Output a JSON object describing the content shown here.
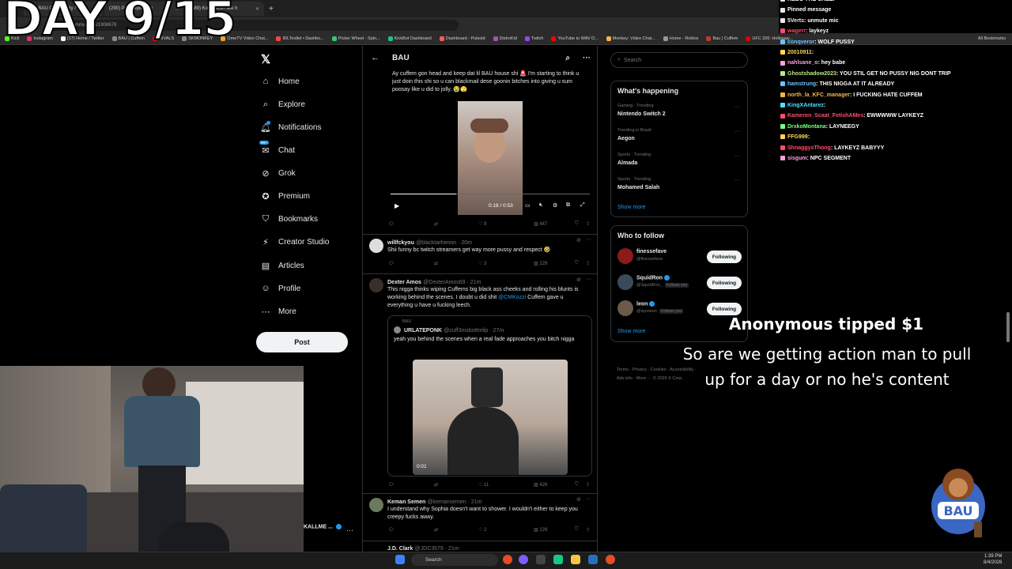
{
  "overlay": {
    "day_label": "DAY 9/15"
  },
  "browser": {
    "tabs": [
      {
        "label": "(91) BAU Community / X"
      },
      {
        "label": "(290) Post replies by"
      },
      {
        "label": "(289) Kozzi actin like h"
      }
    ],
    "url": "x.com/i/communities/1908678",
    "bookmarks": [
      "Kick",
      "Instagram",
      "(17) Home / Twitter",
      "BAU | Cuffem",
      "RIVALS",
      "SKMONKEY",
      "OmeTV Video Chat...",
      "IRLToolkit • Dashbo...",
      "Picker Wheel - Spin...",
      "KickBot Dashboard",
      "Dashboard - Pulsoid",
      "DistroKid",
      "Twitch",
      "YouTube to WAV D...",
      "Monkey: Video Chat...",
      "Home - Roblox",
      "Bau | Cuffem",
      "UFC 326: Holloway..."
    ],
    "all_bookmarks": "All Bookmarks"
  },
  "nav": {
    "items": [
      {
        "label": "Home",
        "icon": "home-icon"
      },
      {
        "label": "Explore",
        "icon": "search-icon"
      },
      {
        "label": "Notifications",
        "icon": "bell-icon"
      },
      {
        "label": "Chat",
        "icon": "chat-icon"
      },
      {
        "label": "Grok",
        "icon": "grok-icon"
      },
      {
        "label": "Premium",
        "icon": "premium-icon"
      },
      {
        "label": "Bookmarks",
        "icon": "bookmark-icon"
      },
      {
        "label": "Creator Studio",
        "icon": "lightning-icon"
      },
      {
        "label": "Articles",
        "icon": "article-icon"
      },
      {
        "label": "Profile",
        "icon": "person-icon"
      },
      {
        "label": "More",
        "icon": "more-icon"
      }
    ],
    "chat_badge": "99+",
    "post_label": "Post",
    "account_name": "KALLME ..."
  },
  "column": {
    "title": "BAU"
  },
  "tweet1": {
    "text": "Ay cuffem gon head and keep dat lil BAU house shi 🚨 I'm starting to think u just doin this shi so u can blackmail dese goonin bitches into giving u sum poosay like u did to jolly. 😭🫣",
    "time": "0:18 / 0:53",
    "likes": "8",
    "views": "447"
  },
  "tweet2": {
    "name": "willfckyou",
    "handle": "@blacktarheroin · 20m",
    "text": "Shii funny bc twitch streamers get way more pussy and respect 🤣",
    "likes": "3",
    "views": "229"
  },
  "tweet3": {
    "name": "Dexter Amos",
    "handle": "@DexterAmos69 · 21m",
    "text_a": "This nigga thinks wiping Cuffems big black ass cheeks and rolling his blunts is working behind the scenes. I doubt u did shit ",
    "mention": "@CMKozzi",
    "text_b": " Cuffem gave u everything u have u fucking leech.",
    "quote_community": "BAU",
    "quote_name": "URLATEPONK",
    "quote_handle": "@cuff3msbottmlip · 27m",
    "quote_text": "yeah you behind the scenes when a real fade approaches you bitch nigga",
    "video_time": "0:01",
    "likes": "11",
    "views": "429"
  },
  "tweet4": {
    "name": "Keman Semen",
    "handle": "@kemansemen · 21m",
    "text": "I understand why Sophia doesn't want to shower. I wouldn't either to keep you creepy fucks away.",
    "likes": "2",
    "views": "229"
  },
  "tweet5": {
    "name": "J.D. Clark",
    "handle": "@JDC3579 · 21m"
  },
  "right": {
    "search_placeholder": "Search",
    "happening_title": "What's happening",
    "trends": [
      {
        "meta": "Gaming · Trending",
        "name": "Nintendo Switch 2"
      },
      {
        "meta": "Trending in Brazil",
        "name": "Aegon"
      },
      {
        "meta": "Sports · Trending",
        "name": "Almada"
      },
      {
        "meta": "Sports · Trending",
        "name": "Mohamed Salah"
      }
    ],
    "show_more": "Show more",
    "wtf_title": "Who to follow",
    "follows": [
      {
        "name": "finessefave",
        "handle": "@finessefave",
        "button": "Following"
      },
      {
        "name": "SquidRon",
        "handle": "@SquidRon_",
        "follows_you": "Follows you",
        "button": "Following"
      },
      {
        "name": "leon",
        "handle": "@wyoleon",
        "follows_you": "Follows you",
        "button": "Following"
      }
    ],
    "footer_a": "Terms · Privacy · Cookies · Accessibility ·",
    "footer_b": "Ads info · More ··· © 2026 X Corp."
  },
  "chat": {
    "messages": [
      {
        "user": "",
        "text": "KEBO THE CREEP",
        "color": "#e7e9ea"
      },
      {
        "user": "",
        "text": "Pinned message",
        "color": "#e7e9ea"
      },
      {
        "user": "5Verts",
        "text": "unmute mic",
        "color": "#e7e9ea"
      },
      {
        "user": "wagerr",
        "text": "laykeyz",
        "color": "#ff4d6d"
      },
      {
        "user": "conqveror",
        "text": "WOLF PUSSY",
        "color": "#6ac1ff"
      },
      {
        "user": "20010911",
        "text": "",
        "color": "#ffd84d"
      },
      {
        "user": "nahlsane_o",
        "text": "hey babe",
        "color": "#ff9ee1"
      },
      {
        "user": "Ghostshadow2023",
        "text": "YOU STIL GET NO PUSSY NIG DONT TRIP",
        "color": "#b8e986"
      },
      {
        "user": "hamstrung",
        "text": "THIS NIGGA AT IT ALREADY",
        "color": "#6ac1ff"
      },
      {
        "user": "north_la_KFC_manager",
        "text": "I FUCKING HATE CUFFEM",
        "color": "#ffb347"
      },
      {
        "user": "KingXAntarez",
        "text": "",
        "color": "#4de1ff"
      },
      {
        "user": "Kameron_Scaat_FetishAMes",
        "text": "EWWWWW LAYKEYZ",
        "color": "#ff4d6d"
      },
      {
        "user": "DrxkoMontana",
        "text": "LAYNEEGY",
        "color": "#7dff7d"
      },
      {
        "user": "FFG999",
        "text": "",
        "color": "#ffd84d"
      },
      {
        "user": "ShnaggysThong",
        "text": "LAYKEYZ BABYYY",
        "color": "#ff4d6d"
      },
      {
        "user": "sisgum",
        "text": "NPC SEGMENT",
        "color": "#ff9ee1"
      }
    ]
  },
  "tip": {
    "title": "Anonymous tipped $1",
    "message": "So are we getting action man to pull up for a day or no he's content"
  },
  "taskbar": {
    "search": "Search",
    "time": "1:39 PM",
    "date": "8/4/2026"
  },
  "colors": {
    "accent": "#1d9bf0",
    "background": "#000000",
    "post_button": "#eff3f4"
  }
}
